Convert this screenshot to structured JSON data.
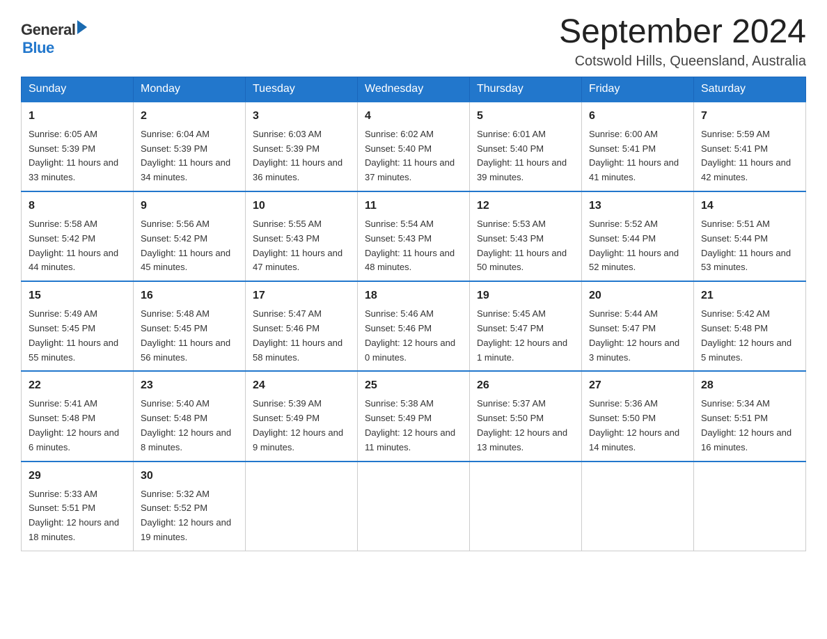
{
  "header": {
    "logo_general": "General",
    "logo_blue": "Blue",
    "title": "September 2024",
    "subtitle": "Cotswold Hills, Queensland, Australia"
  },
  "weekdays": [
    "Sunday",
    "Monday",
    "Tuesday",
    "Wednesday",
    "Thursday",
    "Friday",
    "Saturday"
  ],
  "weeks": [
    [
      {
        "day": "1",
        "sunrise": "6:05 AM",
        "sunset": "5:39 PM",
        "daylight": "11 hours and 33 minutes."
      },
      {
        "day": "2",
        "sunrise": "6:04 AM",
        "sunset": "5:39 PM",
        "daylight": "11 hours and 34 minutes."
      },
      {
        "day": "3",
        "sunrise": "6:03 AM",
        "sunset": "5:39 PM",
        "daylight": "11 hours and 36 minutes."
      },
      {
        "day": "4",
        "sunrise": "6:02 AM",
        "sunset": "5:40 PM",
        "daylight": "11 hours and 37 minutes."
      },
      {
        "day": "5",
        "sunrise": "6:01 AM",
        "sunset": "5:40 PM",
        "daylight": "11 hours and 39 minutes."
      },
      {
        "day": "6",
        "sunrise": "6:00 AM",
        "sunset": "5:41 PM",
        "daylight": "11 hours and 41 minutes."
      },
      {
        "day": "7",
        "sunrise": "5:59 AM",
        "sunset": "5:41 PM",
        "daylight": "11 hours and 42 minutes."
      }
    ],
    [
      {
        "day": "8",
        "sunrise": "5:58 AM",
        "sunset": "5:42 PM",
        "daylight": "11 hours and 44 minutes."
      },
      {
        "day": "9",
        "sunrise": "5:56 AM",
        "sunset": "5:42 PM",
        "daylight": "11 hours and 45 minutes."
      },
      {
        "day": "10",
        "sunrise": "5:55 AM",
        "sunset": "5:43 PM",
        "daylight": "11 hours and 47 minutes."
      },
      {
        "day": "11",
        "sunrise": "5:54 AM",
        "sunset": "5:43 PM",
        "daylight": "11 hours and 48 minutes."
      },
      {
        "day": "12",
        "sunrise": "5:53 AM",
        "sunset": "5:43 PM",
        "daylight": "11 hours and 50 minutes."
      },
      {
        "day": "13",
        "sunrise": "5:52 AM",
        "sunset": "5:44 PM",
        "daylight": "11 hours and 52 minutes."
      },
      {
        "day": "14",
        "sunrise": "5:51 AM",
        "sunset": "5:44 PM",
        "daylight": "11 hours and 53 minutes."
      }
    ],
    [
      {
        "day": "15",
        "sunrise": "5:49 AM",
        "sunset": "5:45 PM",
        "daylight": "11 hours and 55 minutes."
      },
      {
        "day": "16",
        "sunrise": "5:48 AM",
        "sunset": "5:45 PM",
        "daylight": "11 hours and 56 minutes."
      },
      {
        "day": "17",
        "sunrise": "5:47 AM",
        "sunset": "5:46 PM",
        "daylight": "11 hours and 58 minutes."
      },
      {
        "day": "18",
        "sunrise": "5:46 AM",
        "sunset": "5:46 PM",
        "daylight": "12 hours and 0 minutes."
      },
      {
        "day": "19",
        "sunrise": "5:45 AM",
        "sunset": "5:47 PM",
        "daylight": "12 hours and 1 minute."
      },
      {
        "day": "20",
        "sunrise": "5:44 AM",
        "sunset": "5:47 PM",
        "daylight": "12 hours and 3 minutes."
      },
      {
        "day": "21",
        "sunrise": "5:42 AM",
        "sunset": "5:48 PM",
        "daylight": "12 hours and 5 minutes."
      }
    ],
    [
      {
        "day": "22",
        "sunrise": "5:41 AM",
        "sunset": "5:48 PM",
        "daylight": "12 hours and 6 minutes."
      },
      {
        "day": "23",
        "sunrise": "5:40 AM",
        "sunset": "5:48 PM",
        "daylight": "12 hours and 8 minutes."
      },
      {
        "day": "24",
        "sunrise": "5:39 AM",
        "sunset": "5:49 PM",
        "daylight": "12 hours and 9 minutes."
      },
      {
        "day": "25",
        "sunrise": "5:38 AM",
        "sunset": "5:49 PM",
        "daylight": "12 hours and 11 minutes."
      },
      {
        "day": "26",
        "sunrise": "5:37 AM",
        "sunset": "5:50 PM",
        "daylight": "12 hours and 13 minutes."
      },
      {
        "day": "27",
        "sunrise": "5:36 AM",
        "sunset": "5:50 PM",
        "daylight": "12 hours and 14 minutes."
      },
      {
        "day": "28",
        "sunrise": "5:34 AM",
        "sunset": "5:51 PM",
        "daylight": "12 hours and 16 minutes."
      }
    ],
    [
      {
        "day": "29",
        "sunrise": "5:33 AM",
        "sunset": "5:51 PM",
        "daylight": "12 hours and 18 minutes."
      },
      {
        "day": "30",
        "sunrise": "5:32 AM",
        "sunset": "5:52 PM",
        "daylight": "12 hours and 19 minutes."
      },
      null,
      null,
      null,
      null,
      null
    ]
  ],
  "labels": {
    "sunrise": "Sunrise:",
    "sunset": "Sunset:",
    "daylight": "Daylight:"
  }
}
